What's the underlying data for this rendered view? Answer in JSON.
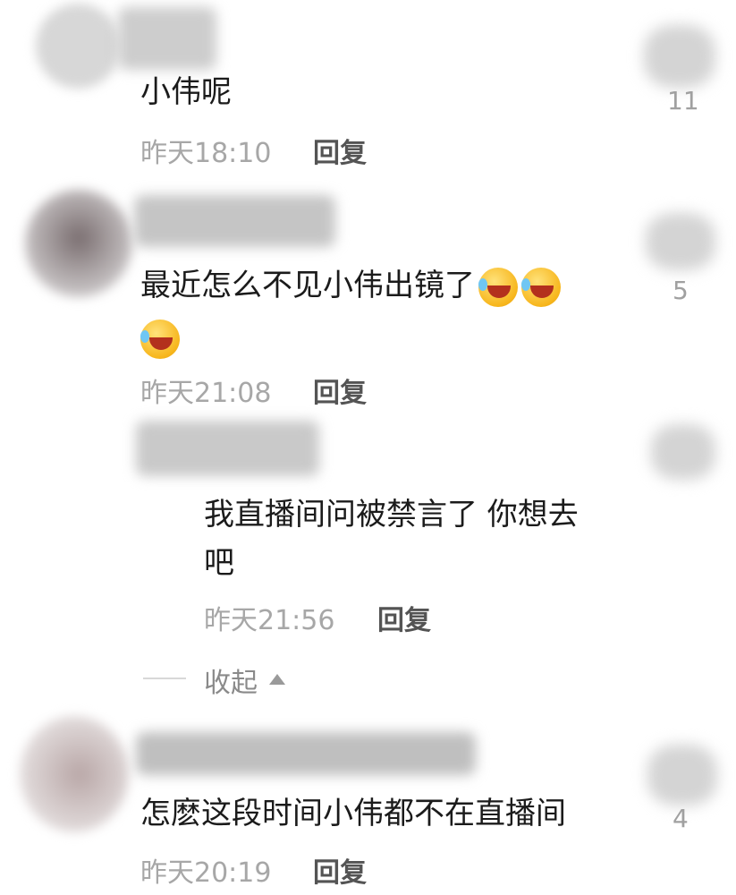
{
  "comments": [
    {
      "text": "小伟呢",
      "time": "昨天18:10",
      "reply_label": "回复",
      "likes": "11"
    },
    {
      "text": "最近怎么不见小伟出镜了",
      "emojis": [
        "laugh-cry-emoji",
        "laugh-cry-emoji",
        "laugh-cry-emoji"
      ],
      "time": "昨天21:08",
      "reply_label": "回复",
      "likes": "5"
    },
    {
      "text_line1": "我直播间问被禁言了 你想去",
      "text_line2": "吧",
      "time": "昨天21:56",
      "reply_label": "回复"
    },
    {
      "text": "怎麽这段时间小伟都不在直播间",
      "time": "昨天20:19",
      "reply_label": "回复",
      "likes": "4"
    }
  ],
  "collapse_label": "收起",
  "collapse_icon": "triangle-up-icon"
}
